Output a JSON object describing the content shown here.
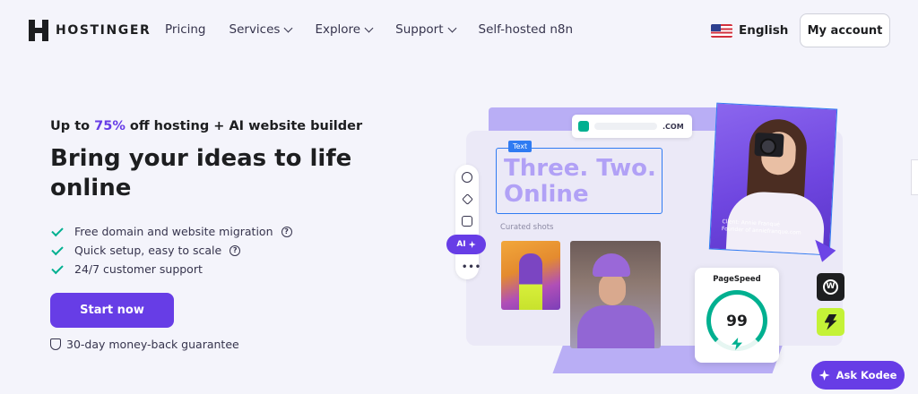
{
  "header": {
    "brand": "HOSTINGER",
    "nav": [
      {
        "label": "Pricing",
        "has_dropdown": false
      },
      {
        "label": "Services",
        "has_dropdown": true
      },
      {
        "label": "Explore",
        "has_dropdown": true
      },
      {
        "label": "Support",
        "has_dropdown": true
      },
      {
        "label": "Self-hosted n8n",
        "has_dropdown": false
      }
    ],
    "language": "English",
    "account_button": "My account"
  },
  "hero": {
    "promo_prefix": "Up to ",
    "promo_percent": "75%",
    "promo_suffix": " off hosting + AI website builder",
    "headline": "Bring your ideas to life online",
    "features": [
      {
        "text": "Free domain and website migration",
        "has_help": true
      },
      {
        "text": "Quick setup, easy to scale",
        "has_help": true
      },
      {
        "text": "24/7 customer support",
        "has_help": false
      }
    ],
    "cta": "Start now",
    "guarantee": "30-day money-back guarantee"
  },
  "illustration": {
    "domain": ".COM",
    "text_tag": "Text",
    "big_text": "Three. Two. Online",
    "curated": "Curated shots",
    "ai_label": "AI",
    "client_line1": "Client: Annie Franqué",
    "client_line2": "Founder of anniefranque.com",
    "pagespeed_title": "PageSpeed",
    "pagespeed_score": "99"
  },
  "chat": {
    "label": "Ask Kodee"
  },
  "colors": {
    "accent": "#673de6",
    "success": "#00b090",
    "text": "#1d1e20"
  }
}
